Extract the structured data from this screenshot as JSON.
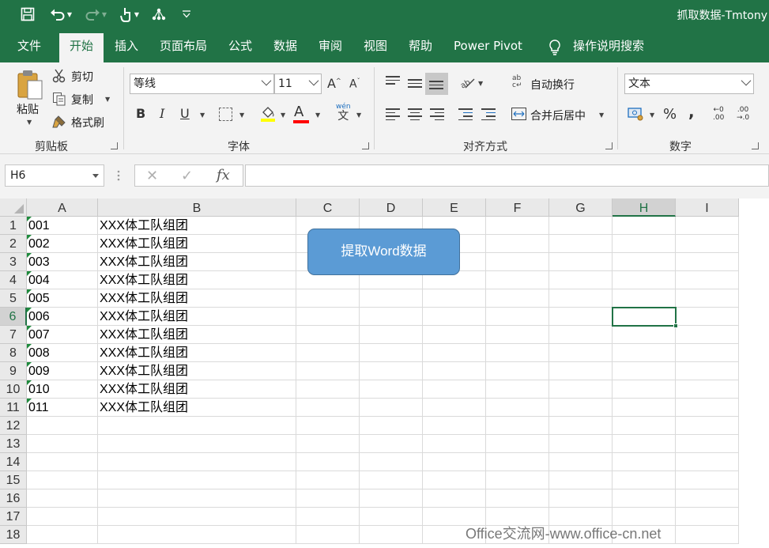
{
  "title_bar": {
    "document_title": "抓取数据-Tmtony",
    "quick_access": [
      {
        "name": "save-icon",
        "glyph": "🖫"
      },
      {
        "name": "undo-icon",
        "glyph": "↶"
      },
      {
        "name": "redo-icon",
        "glyph": "↷"
      },
      {
        "name": "touch-mode-icon",
        "glyph": "☝"
      },
      {
        "name": "network-icon",
        "glyph": "⁂"
      },
      {
        "name": "customize-icon",
        "glyph": "▿"
      }
    ]
  },
  "tabs": [
    "文件",
    "开始",
    "插入",
    "页面布局",
    "公式",
    "数据",
    "审阅",
    "视图",
    "帮助",
    "Power Pivot",
    "操作说明搜索"
  ],
  "active_tab_index": 1,
  "ribbon": {
    "clipboard": {
      "paste": "粘贴",
      "cut": "剪切",
      "copy": "复制",
      "format_painter": "格式刷",
      "label": "剪贴板"
    },
    "font": {
      "name": "等线",
      "size": "11",
      "grow": "A",
      "shrink": "A",
      "bold": "B",
      "italic": "I",
      "underline": "U",
      "font_color": "A",
      "phonetic_top": "wén",
      "phonetic_bottom": "文",
      "label": "字体"
    },
    "alignment": {
      "wrap": "自动换行",
      "merge": "合并后居中",
      "label": "对齐方式"
    },
    "number": {
      "format": "文本",
      "percent": "%",
      "comma": ",",
      "inc_top": "←0",
      "inc_bottom": ".00",
      "dec_top": ".00",
      "dec_bottom": "→.0",
      "label": "数字"
    }
  },
  "formula_bar": {
    "name_box": "H6",
    "cancel": "✕",
    "enter": "✓",
    "fx": "fx",
    "formula": ""
  },
  "columns": [
    "A",
    "B",
    "C",
    "D",
    "E",
    "F",
    "G",
    "H",
    "I"
  ],
  "selected_column": "H",
  "rows": [
    "1",
    "2",
    "3",
    "4",
    "5",
    "6",
    "7",
    "8",
    "9",
    "10",
    "11",
    "12",
    "13",
    "14",
    "15",
    "16",
    "17",
    "18"
  ],
  "selected_row": "6",
  "cells": [
    {
      "a": "001",
      "b": "XXX体工队组团"
    },
    {
      "a": "002",
      "b": "XXX体工队组团"
    },
    {
      "a": "003",
      "b": "XXX体工队组团"
    },
    {
      "a": "004",
      "b": "XXX体工队组团"
    },
    {
      "a": "005",
      "b": "XXX体工队组团"
    },
    {
      "a": "006",
      "b": "XXX体工队组团"
    },
    {
      "a": "007",
      "b": "XXX体工队组团"
    },
    {
      "a": "008",
      "b": "XXX体工队组团"
    },
    {
      "a": "009",
      "b": "XXX体工队组团"
    },
    {
      "a": "010",
      "b": "XXX体工队组团"
    },
    {
      "a": "011",
      "b": "XXX体工队组团"
    }
  ],
  "macro_button": "提取Word数据",
  "watermark": "Office交流网-www.office-cn.net",
  "colors": {
    "brand": "#217346",
    "button_fill": "#5b9bd5",
    "button_border": "#41719c",
    "fill_yellow": "#ffff00",
    "font_red": "#ff0000"
  }
}
